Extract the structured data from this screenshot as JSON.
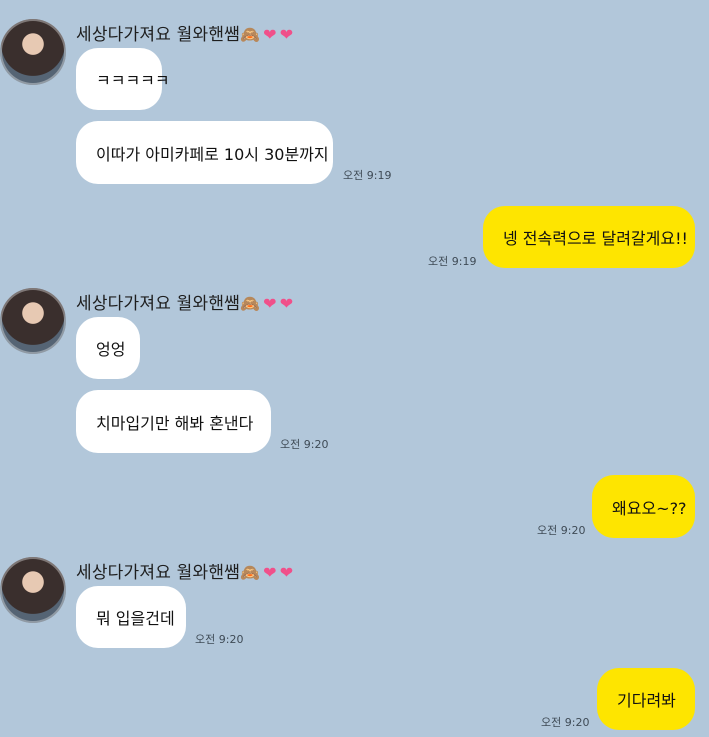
{
  "sender": {
    "name": "세상다가져요 월와핸쌤",
    "name_emoji": "🙈❤❤"
  },
  "messages": [
    {
      "from": "other",
      "text": "ㅋㅋㅋㅋㅋ"
    },
    {
      "from": "other",
      "text": "이따가 아미카페로 10시 30분까지",
      "time": "오전 9:19"
    },
    {
      "from": "me",
      "text": "넹 전속력으로 달려갈게요!!",
      "time": "오전 9:19"
    },
    {
      "from": "other",
      "text": "엉엉"
    },
    {
      "from": "other",
      "text": "치마입기만 해봐 혼낸다",
      "time": "오전 9:20"
    },
    {
      "from": "me",
      "text": "왜요오~??",
      "time": "오전 9:20"
    },
    {
      "from": "other",
      "text": "뭐 입을건데",
      "time": "오전 9:20"
    },
    {
      "from": "me",
      "text": "기다려봐",
      "time": "오전 9:20"
    }
  ],
  "colors": {
    "background": "#b2c7da",
    "incoming_bubble": "#ffffff",
    "outgoing_bubble": "#fee500"
  }
}
